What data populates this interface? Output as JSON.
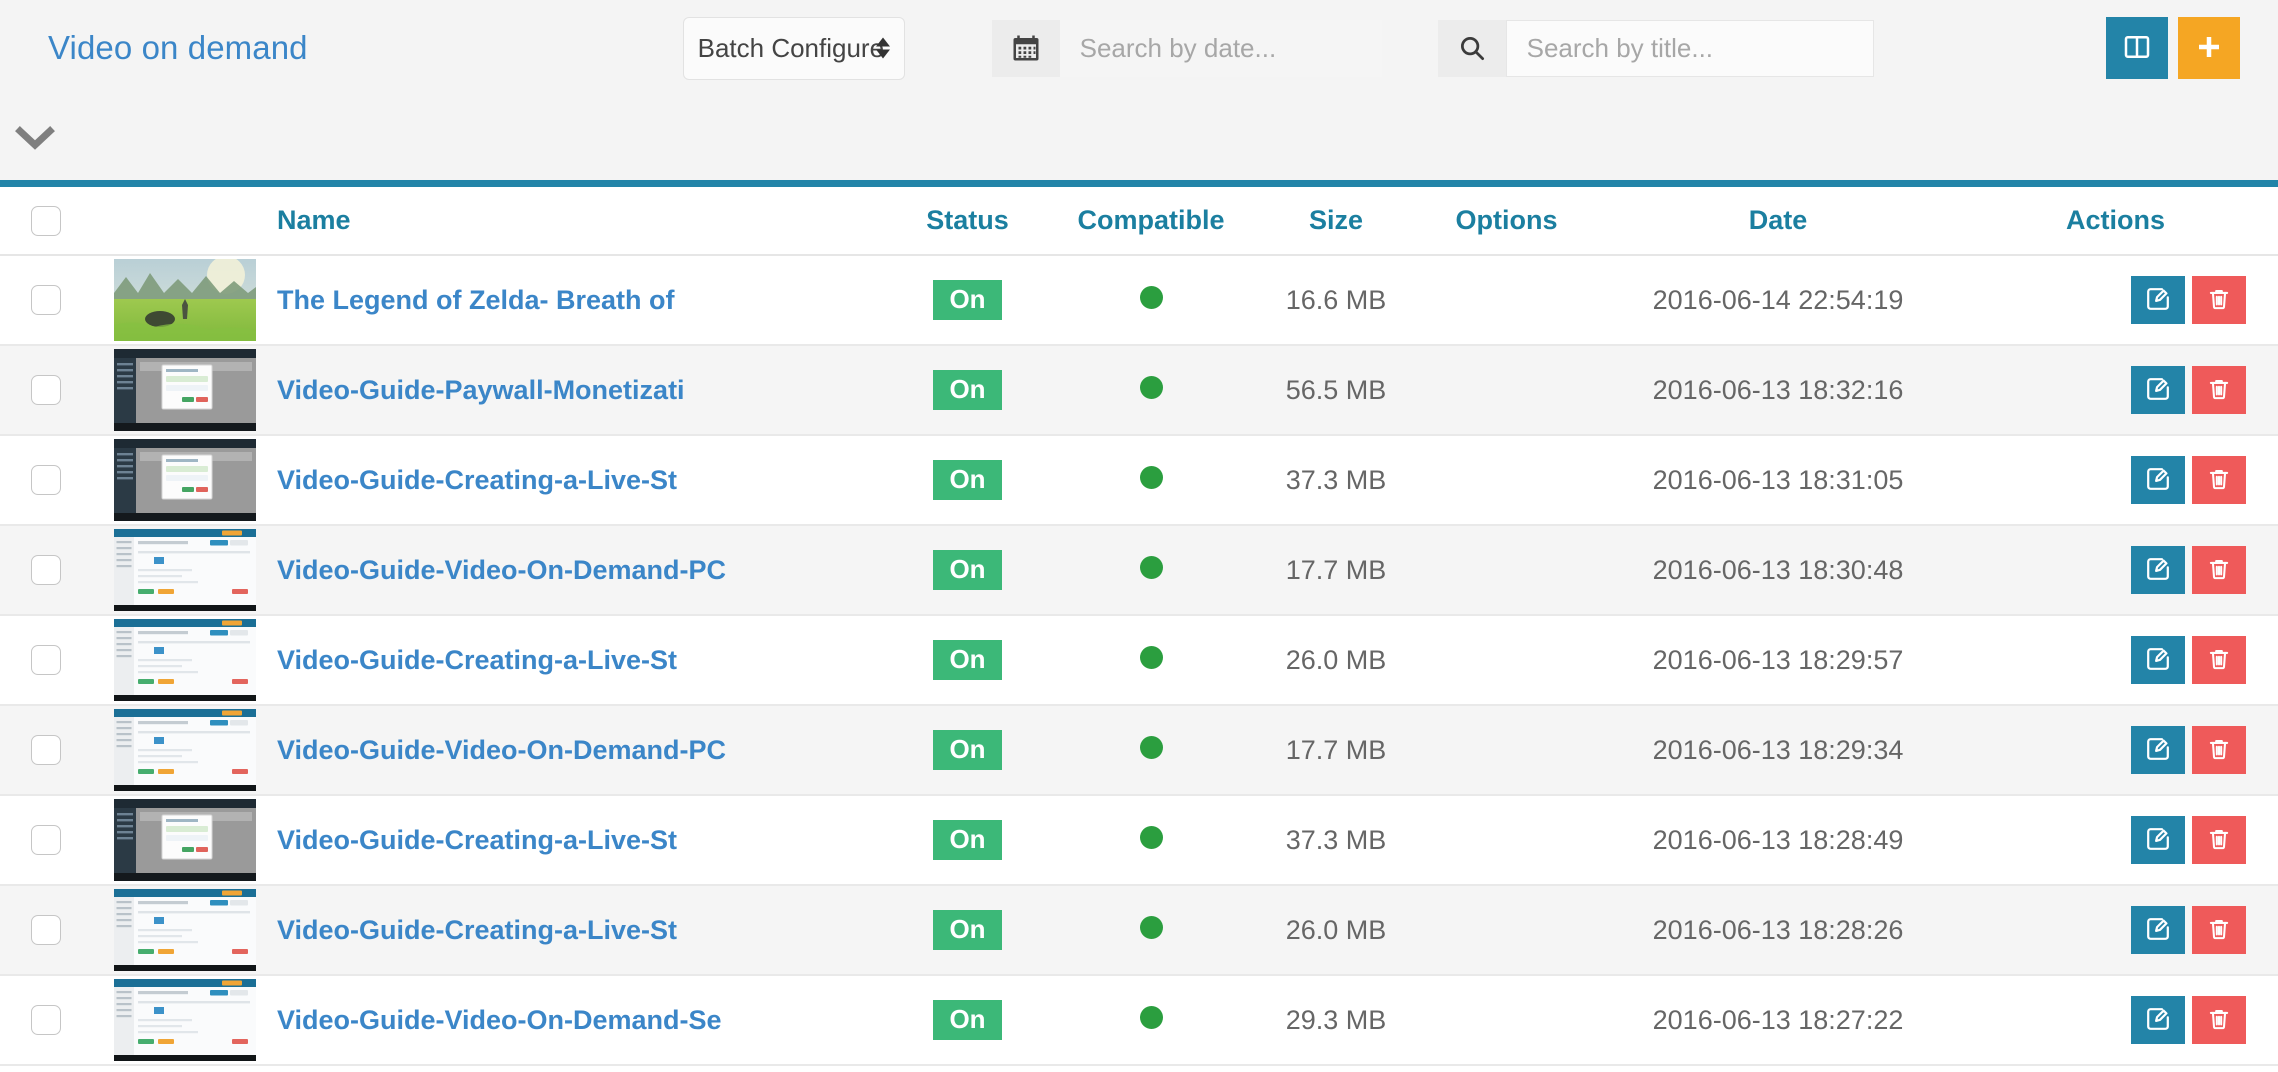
{
  "header": {
    "title": "Video on demand",
    "batch_select": {
      "label": "Batch Configure",
      "icon": "updown-arrows-icon"
    },
    "date_search": {
      "placeholder": "Search by date...",
      "value": "",
      "icon": "calendar-icon"
    },
    "title_search": {
      "placeholder": "Search by title...",
      "value": "",
      "icon": "search-icon"
    },
    "columns_button": {
      "icon": "columns-icon",
      "color": "#2384a8"
    },
    "add_button": {
      "icon": "plus-icon",
      "color": "#f5a623"
    },
    "collapse_toggle": {
      "icon": "chevron-down-icon"
    },
    "accent_color": "#2284a8"
  },
  "table": {
    "columns": [
      {
        "key": "check",
        "label": ""
      },
      {
        "key": "thumb",
        "label": ""
      },
      {
        "key": "name",
        "label": "Name"
      },
      {
        "key": "status",
        "label": "Status"
      },
      {
        "key": "compat",
        "label": "Compatible"
      },
      {
        "key": "size",
        "label": "Size"
      },
      {
        "key": "options",
        "label": "Options"
      },
      {
        "key": "date",
        "label": "Date"
      },
      {
        "key": "actions",
        "label": "Actions"
      }
    ],
    "select_all_checkbox": {
      "checked": false
    },
    "row_actions": {
      "edit": {
        "icon": "edit-icon",
        "color": "#2384a8"
      },
      "delete": {
        "icon": "trash-icon",
        "color": "#ef5a5a"
      }
    },
    "rows": [
      {
        "name": "The Legend of Zelda- Breath of",
        "status": "On",
        "compatible": true,
        "size": "16.6 MB",
        "options": "",
        "date": "2016-06-14 22:54:19",
        "thumb": "landscape"
      },
      {
        "name": "Video-Guide-Paywall-Monetizati",
        "status": "On",
        "compatible": true,
        "size": "56.5 MB",
        "options": "",
        "date": "2016-06-13 18:32:16",
        "thumb": "dark-dashboard"
      },
      {
        "name": "Video-Guide-Creating-a-Live-St",
        "status": "On",
        "compatible": true,
        "size": "37.3 MB",
        "options": "",
        "date": "2016-06-13 18:31:05",
        "thumb": "dark-dashboard"
      },
      {
        "name": "Video-Guide-Video-On-Demand-PC",
        "status": "On",
        "compatible": true,
        "size": "17.7 MB",
        "options": "",
        "date": "2016-06-13 18:30:48",
        "thumb": "light-dashboard"
      },
      {
        "name": "Video-Guide-Creating-a-Live-St",
        "status": "On",
        "compatible": true,
        "size": "26.0 MB",
        "options": "",
        "date": "2016-06-13 18:29:57",
        "thumb": "light-dashboard"
      },
      {
        "name": "Video-Guide-Video-On-Demand-PC",
        "status": "On",
        "compatible": true,
        "size": "17.7 MB",
        "options": "",
        "date": "2016-06-13 18:29:34",
        "thumb": "light-dashboard"
      },
      {
        "name": "Video-Guide-Creating-a-Live-St",
        "status": "On",
        "compatible": true,
        "size": "37.3 MB",
        "options": "",
        "date": "2016-06-13 18:28:49",
        "thumb": "dark-dashboard"
      },
      {
        "name": "Video-Guide-Creating-a-Live-St",
        "status": "On",
        "compatible": true,
        "size": "26.0 MB",
        "options": "",
        "date": "2016-06-13 18:28:26",
        "thumb": "light-dashboard"
      },
      {
        "name": "Video-Guide-Video-On-Demand-Se",
        "status": "On",
        "compatible": true,
        "size": "29.3 MB",
        "options": "",
        "date": "2016-06-13 18:27:22",
        "thumb": "light-dashboard"
      }
    ]
  }
}
